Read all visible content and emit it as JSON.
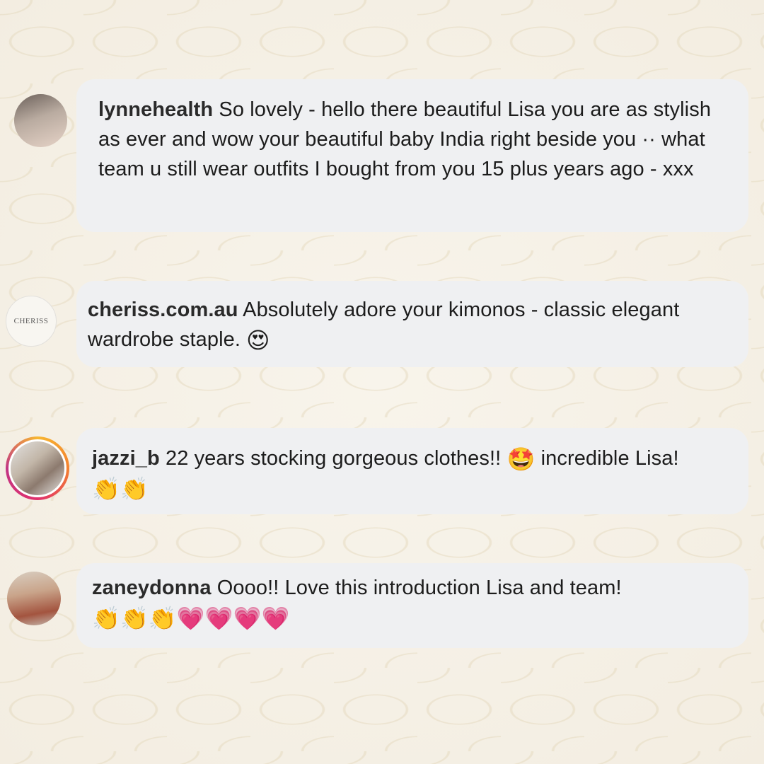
{
  "comments": [
    {
      "username": "lynnehealth",
      "text": "So lovely - hello there beautiful Lisa you are as stylish as ever and wow your beautiful baby India right beside you ·· what team u still wear outfits I bought from you 15 plus years ago - xxx",
      "avatar_icon": "profile-photo"
    },
    {
      "username": "cheriss.com.au",
      "text": "Absolutely adore your kimonos - classic elegant wardrobe staple.",
      "emojis": "😍",
      "avatar_logo_text": "CHERISS",
      "avatar_icon": "brand-logo"
    },
    {
      "username": "jazzi_b",
      "text": "22 years stocking gorgeous clothes!!",
      "emoji_mid": "🤩",
      "text2": "incredible Lisa!",
      "emojis": "👏👏",
      "avatar_icon": "profile-photo-story-ring"
    },
    {
      "username": "zaneydonna",
      "text": "Oooo!! Love this introduction Lisa and team!",
      "emojis": "👏👏👏💗💗💗💗",
      "avatar_icon": "profile-photo"
    }
  ],
  "colors": {
    "background": "#f6f1e7",
    "bubble": "#eff0f2",
    "text": "#1c1c1c"
  }
}
